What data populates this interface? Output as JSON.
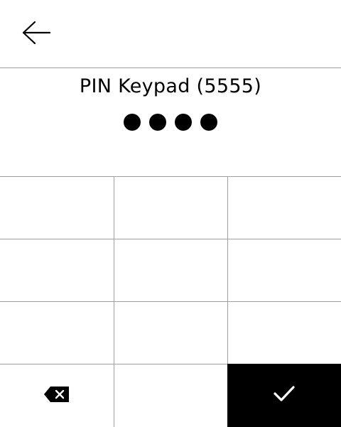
{
  "header": {
    "back_icon": "arrow-left-icon"
  },
  "pin": {
    "title": "PIN Keypad (5555)",
    "entered_count": 4,
    "dot_color": "#000000"
  },
  "keypad": {
    "keys": [
      {
        "label": ""
      },
      {
        "label": ""
      },
      {
        "label": ""
      },
      {
        "label": ""
      },
      {
        "label": ""
      },
      {
        "label": ""
      },
      {
        "label": ""
      },
      {
        "label": ""
      },
      {
        "label": ""
      },
      {
        "label": "",
        "icon": "backspace-icon"
      },
      {
        "label": ""
      },
      {
        "label": "",
        "icon": "check-icon",
        "background": "#000000"
      }
    ],
    "border_color": "#9e9e9e"
  }
}
